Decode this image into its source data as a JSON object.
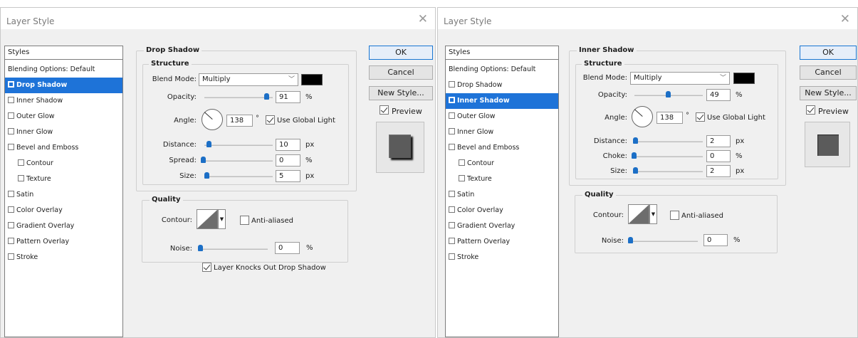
{
  "dialogs": [
    {
      "title": "Layer Style",
      "styles_header": "Styles",
      "styles_list": [
        {
          "label": "Blending Options: Default",
          "checkbox": false,
          "checked": false,
          "selected": false,
          "indent": false
        },
        {
          "label": "Drop Shadow",
          "checkbox": true,
          "checked": true,
          "selected": true,
          "indent": false
        },
        {
          "label": "Inner Shadow",
          "checkbox": true,
          "checked": false,
          "selected": false,
          "indent": false
        },
        {
          "label": "Outer Glow",
          "checkbox": true,
          "checked": false,
          "selected": false,
          "indent": false
        },
        {
          "label": "Inner Glow",
          "checkbox": true,
          "checked": false,
          "selected": false,
          "indent": false
        },
        {
          "label": "Bevel and Emboss",
          "checkbox": true,
          "checked": false,
          "selected": false,
          "indent": false
        },
        {
          "label": "Contour",
          "checkbox": true,
          "checked": false,
          "selected": false,
          "indent": true
        },
        {
          "label": "Texture",
          "checkbox": true,
          "checked": false,
          "selected": false,
          "indent": true
        },
        {
          "label": "Satin",
          "checkbox": true,
          "checked": false,
          "selected": false,
          "indent": false
        },
        {
          "label": "Color Overlay",
          "checkbox": true,
          "checked": false,
          "selected": false,
          "indent": false
        },
        {
          "label": "Gradient Overlay",
          "checkbox": true,
          "checked": false,
          "selected": false,
          "indent": false
        },
        {
          "label": "Pattern Overlay",
          "checkbox": true,
          "checked": false,
          "selected": false,
          "indent": false
        },
        {
          "label": "Stroke",
          "checkbox": true,
          "checked": false,
          "selected": false,
          "indent": false
        }
      ],
      "section_title": "Drop Shadow",
      "structure_label": "Structure",
      "blend_mode_label": "Blend Mode:",
      "blend_mode_value": "Multiply",
      "opacity_label": "Opacity:",
      "opacity_value": "91",
      "opacity_level_pct": 91,
      "angle_label": "Angle:",
      "angle_value": "138",
      "degree_symbol": "°",
      "use_global_light": "Use Global Light",
      "distance_label": "Distance:",
      "distance_value": "10",
      "third_label": "Spread:",
      "third_value": "0",
      "size_label": "Size:",
      "size_value": "5",
      "unit_px": "px",
      "unit_pct": "%",
      "quality_label": "Quality",
      "contour_label": "Contour:",
      "anti_aliased": "Anti-aliased",
      "noise_label": "Noise:",
      "noise_value": "0",
      "extra_checkbox": "Layer Knocks Out Drop Shadow",
      "ok": "OK",
      "cancel": "Cancel",
      "new_style": "New Style...",
      "preview": "Preview"
    },
    {
      "title": "Layer Style",
      "styles_header": "Styles",
      "styles_list": [
        {
          "label": "Blending Options: Default",
          "checkbox": false,
          "checked": false,
          "selected": false,
          "indent": false
        },
        {
          "label": "Drop Shadow",
          "checkbox": true,
          "checked": false,
          "selected": false,
          "indent": false
        },
        {
          "label": "Inner Shadow",
          "checkbox": true,
          "checked": true,
          "selected": true,
          "indent": false
        },
        {
          "label": "Outer Glow",
          "checkbox": true,
          "checked": false,
          "selected": false,
          "indent": false
        },
        {
          "label": "Inner Glow",
          "checkbox": true,
          "checked": false,
          "selected": false,
          "indent": false
        },
        {
          "label": "Bevel and Emboss",
          "checkbox": true,
          "checked": false,
          "selected": false,
          "indent": false
        },
        {
          "label": "Contour",
          "checkbox": true,
          "checked": false,
          "selected": false,
          "indent": true
        },
        {
          "label": "Texture",
          "checkbox": true,
          "checked": false,
          "selected": false,
          "indent": true
        },
        {
          "label": "Satin",
          "checkbox": true,
          "checked": false,
          "selected": false,
          "indent": false
        },
        {
          "label": "Color Overlay",
          "checkbox": true,
          "checked": false,
          "selected": false,
          "indent": false
        },
        {
          "label": "Gradient Overlay",
          "checkbox": true,
          "checked": false,
          "selected": false,
          "indent": false
        },
        {
          "label": "Pattern Overlay",
          "checkbox": true,
          "checked": false,
          "selected": false,
          "indent": false
        },
        {
          "label": "Stroke",
          "checkbox": true,
          "checked": false,
          "selected": false,
          "indent": false
        }
      ],
      "section_title": "Inner Shadow",
      "structure_label": "Structure",
      "blend_mode_label": "Blend Mode:",
      "blend_mode_value": "Multiply",
      "opacity_label": "Opacity:",
      "opacity_value": "49",
      "opacity_level_pct": 49,
      "angle_label": "Angle:",
      "angle_value": "138",
      "degree_symbol": "°",
      "use_global_light": "Use Global Light",
      "distance_label": "Distance:",
      "distance_value": "2",
      "third_label": "Choke:",
      "third_value": "0",
      "size_label": "Size:",
      "size_value": "2",
      "unit_px": "px",
      "unit_pct": "%",
      "quality_label": "Quality",
      "contour_label": "Contour:",
      "anti_aliased": "Anti-aliased",
      "noise_label": "Noise:",
      "noise_value": "0",
      "ok": "OK",
      "cancel": "Cancel",
      "new_style": "New Style...",
      "preview": "Preview"
    }
  ],
  "colors": {
    "selection_blue": "#1e73d8",
    "slider_blue": "#1c6fc6",
    "shadow_color": "#000000",
    "dialog_bg": "#f0f0f0"
  },
  "icons": {
    "close": "close-icon",
    "dropdown": "chevron-down-icon",
    "angle_dial": "angle-dial-icon"
  }
}
